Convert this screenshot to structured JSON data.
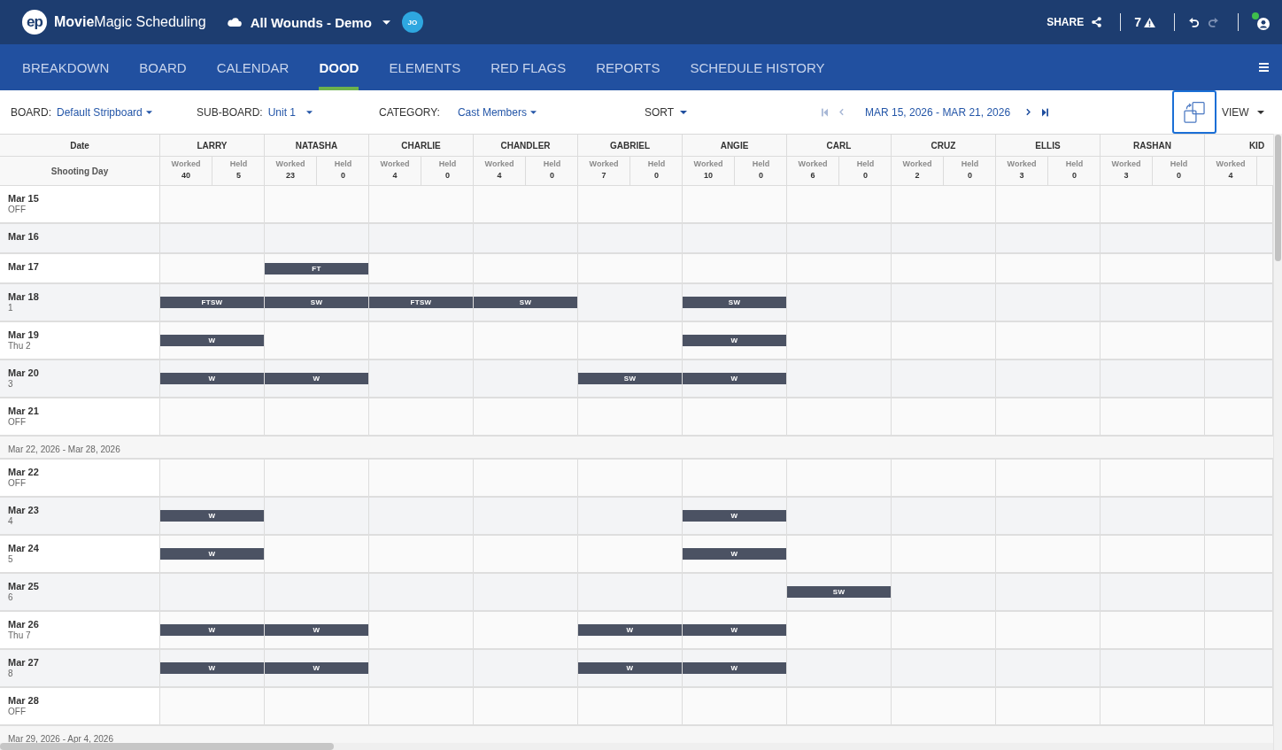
{
  "header": {
    "logo_mark": "ep",
    "app_name": "**Movie**Magic Scheduling",
    "project": "All Wounds - Demo",
    "avatar_initials": "JO",
    "share_label": "SHARE",
    "alert_count": "7",
    "undo": {
      "disabled": false
    },
    "redo": {
      "disabled": true
    },
    "user": {
      "online": true
    }
  },
  "tabs": [
    {
      "label": "BREAKDOWN",
      "selected": false
    },
    {
      "label": "BOARD",
      "selected": false
    },
    {
      "label": "CALENDAR",
      "selected": false
    },
    {
      "label": "DOOD",
      "selected": true
    },
    {
      "label": "ELEMENTS",
      "selected": false
    },
    {
      "label": "RED FLAGS",
      "selected": false
    },
    {
      "label": "REPORTS",
      "selected": false
    },
    {
      "label": "SCHEDULE HISTORY",
      "selected": false
    }
  ],
  "toolbar": {
    "filters": [
      {
        "label": "BOARD:",
        "value": "Default Stripboard"
      },
      {
        "label": "SUB-BOARD:",
        "value": "Unit 1"
      },
      {
        "label": "CATEGORY:",
        "value": "Cast Members"
      }
    ],
    "sort_label": "SORT",
    "date_nav": {
      "first_disabled": true,
      "previous_disabled": true,
      "range": "MAR 15, 2026 - MAR 21, 2026",
      "next_disabled": false,
      "last_disabled": false
    },
    "layout_button": {
      "highlighted": true
    },
    "view_label": "VIEW"
  },
  "table": {
    "date_header": "Date",
    "shooting_day_header": "Shooting Day",
    "cast": [
      {
        "name": "LARRY",
        "worked_label": "Worked",
        "worked": "40",
        "held_label": "Held",
        "held": "5"
      },
      {
        "name": "NATASHA",
        "worked_label": "Worked",
        "worked": "23",
        "held_label": "Held",
        "held": "0"
      },
      {
        "name": "CHARLIE",
        "worked_label": "Worked",
        "worked": "4",
        "held_label": "Held",
        "held": "0"
      },
      {
        "name": "CHANDLER",
        "worked_label": "Worked",
        "worked": "4",
        "held_label": "Held",
        "held": "0"
      },
      {
        "name": "GABRIEL",
        "worked_label": "Worked",
        "worked": "7",
        "held_label": "Held",
        "held": "0"
      },
      {
        "name": "ANGIE",
        "worked_label": "Worked",
        "worked": "10",
        "held_label": "Held",
        "held": "0"
      },
      {
        "name": "CARL",
        "worked_label": "Worked",
        "worked": "6",
        "held_label": "Held",
        "held": "0"
      },
      {
        "name": "CRUZ",
        "worked_label": "Worked",
        "worked": "2",
        "held_label": "Held",
        "held": "0"
      },
      {
        "name": "ELLIS",
        "worked_label": "Worked",
        "worked": "3",
        "held_label": "Held",
        "held": "0"
      },
      {
        "name": "RASHAN",
        "worked_label": "Worked",
        "worked": "3",
        "held_label": "Held",
        "held": "0"
      },
      {
        "name": "KID",
        "worked_label": "Worked",
        "worked": "4"
      }
    ],
    "rows": [
      {
        "kind": "day",
        "date": "Mar 15",
        "note": "OFF",
        "cells": [
          {
            "booked": false
          },
          {
            "booked": false
          },
          {
            "booked": false
          },
          {
            "booked": false
          },
          {
            "booked": false
          },
          {
            "booked": false
          },
          {
            "booked": false
          },
          {
            "booked": false
          },
          {
            "booked": false
          },
          {
            "booked": false
          },
          {
            "booked": false
          }
        ]
      },
      {
        "kind": "day",
        "date": "Mar 16",
        "cells": [
          {
            "booked": false
          },
          {
            "booked": false
          },
          {
            "booked": false
          },
          {
            "booked": false
          },
          {
            "booked": false
          },
          {
            "booked": false
          },
          {
            "booked": false
          },
          {
            "booked": false
          },
          {
            "booked": false
          },
          {
            "booked": false
          },
          {
            "booked": false
          }
        ]
      },
      {
        "kind": "day",
        "date": "Mar 17",
        "cells": [
          {
            "booked": false
          },
          {
            "booked": true,
            "code": "FT"
          },
          {
            "booked": false
          },
          {
            "booked": false
          },
          {
            "booked": false
          },
          {
            "booked": false
          },
          {
            "booked": false
          },
          {
            "booked": false
          },
          {
            "booked": false
          },
          {
            "booked": false
          },
          {
            "booked": false
          }
        ]
      },
      {
        "kind": "day",
        "date": "Mar 18",
        "note": "1",
        "cells": [
          {
            "booked": true,
            "code": "FTSW"
          },
          {
            "booked": true,
            "code": "SW"
          },
          {
            "booked": true,
            "code": "FTSW"
          },
          {
            "booked": true,
            "code": "SW"
          },
          {
            "booked": false
          },
          {
            "booked": true,
            "code": "SW"
          },
          {
            "booked": false
          },
          {
            "booked": false
          },
          {
            "booked": false
          },
          {
            "booked": false
          },
          {
            "booked": false
          }
        ]
      },
      {
        "kind": "day",
        "date": "Mar 19",
        "note": "Thu 2",
        "cells": [
          {
            "booked": true,
            "code": "W"
          },
          {
            "booked": false
          },
          {
            "booked": false
          },
          {
            "booked": false
          },
          {
            "booked": false
          },
          {
            "booked": true,
            "code": "W"
          },
          {
            "booked": false
          },
          {
            "booked": false
          },
          {
            "booked": false
          },
          {
            "booked": false
          },
          {
            "booked": false
          }
        ]
      },
      {
        "kind": "day",
        "date": "Mar 20",
        "note": "3",
        "cells": [
          {
            "booked": true,
            "code": "W"
          },
          {
            "booked": true,
            "code": "W"
          },
          {
            "booked": false
          },
          {
            "booked": false
          },
          {
            "booked": true,
            "code": "SW"
          },
          {
            "booked": true,
            "code": "W"
          },
          {
            "booked": false
          },
          {
            "booked": false
          },
          {
            "booked": false
          },
          {
            "booked": false
          },
          {
            "booked": false
          }
        ]
      },
      {
        "kind": "day",
        "date": "Mar 21",
        "note": "OFF",
        "cells": [
          {
            "booked": false
          },
          {
            "booked": false
          },
          {
            "booked": false
          },
          {
            "booked": false
          },
          {
            "booked": false
          },
          {
            "booked": false
          },
          {
            "booked": false
          },
          {
            "booked": false
          },
          {
            "booked": false
          },
          {
            "booked": false
          },
          {
            "booked": false
          }
        ]
      },
      {
        "kind": "week",
        "label": "Mar 22, 2026 - Mar 28, 2026"
      },
      {
        "kind": "day",
        "date": "Mar 22",
        "note": "OFF",
        "cells": [
          {
            "booked": false
          },
          {
            "booked": false
          },
          {
            "booked": false
          },
          {
            "booked": false
          },
          {
            "booked": false
          },
          {
            "booked": false
          },
          {
            "booked": false
          },
          {
            "booked": false
          },
          {
            "booked": false
          },
          {
            "booked": false
          },
          {
            "booked": false
          }
        ]
      },
      {
        "kind": "day",
        "date": "Mar 23",
        "note": "4",
        "cells": [
          {
            "booked": true,
            "code": "W"
          },
          {
            "booked": false
          },
          {
            "booked": false
          },
          {
            "booked": false
          },
          {
            "booked": false
          },
          {
            "booked": true,
            "code": "W"
          },
          {
            "booked": false
          },
          {
            "booked": false
          },
          {
            "booked": false
          },
          {
            "booked": false
          },
          {
            "booked": false
          }
        ]
      },
      {
        "kind": "day",
        "date": "Mar 24",
        "note": "5",
        "cells": [
          {
            "booked": true,
            "code": "W"
          },
          {
            "booked": false
          },
          {
            "booked": false
          },
          {
            "booked": false
          },
          {
            "booked": false
          },
          {
            "booked": true,
            "code": "W"
          },
          {
            "booked": false
          },
          {
            "booked": false
          },
          {
            "booked": false
          },
          {
            "booked": false
          },
          {
            "booked": false
          }
        ]
      },
      {
        "kind": "day",
        "date": "Mar 25",
        "note": "6",
        "cells": [
          {
            "booked": false
          },
          {
            "booked": false
          },
          {
            "booked": false
          },
          {
            "booked": false
          },
          {
            "booked": false
          },
          {
            "booked": false
          },
          {
            "booked": true,
            "code": "SW"
          },
          {
            "booked": false
          },
          {
            "booked": false
          },
          {
            "booked": false
          },
          {
            "booked": false
          }
        ]
      },
      {
        "kind": "day",
        "date": "Mar 26",
        "note": "Thu 7",
        "cells": [
          {
            "booked": true,
            "code": "W"
          },
          {
            "booked": true,
            "code": "W"
          },
          {
            "booked": false
          },
          {
            "booked": false
          },
          {
            "booked": true,
            "code": "W"
          },
          {
            "booked": true,
            "code": "W"
          },
          {
            "booked": false
          },
          {
            "booked": false
          },
          {
            "booked": false
          },
          {
            "booked": false
          },
          {
            "booked": false
          }
        ]
      },
      {
        "kind": "day",
        "date": "Mar 27",
        "note": "8",
        "cells": [
          {
            "booked": true,
            "code": "W"
          },
          {
            "booked": true,
            "code": "W"
          },
          {
            "booked": false
          },
          {
            "booked": false
          },
          {
            "booked": true,
            "code": "W"
          },
          {
            "booked": true,
            "code": "W"
          },
          {
            "booked": false
          },
          {
            "booked": false
          },
          {
            "booked": false
          },
          {
            "booked": false
          },
          {
            "booked": false
          }
        ]
      },
      {
        "kind": "day",
        "date": "Mar 28",
        "note": "OFF",
        "cells": [
          {
            "booked": false
          },
          {
            "booked": false
          },
          {
            "booked": false
          },
          {
            "booked": false
          },
          {
            "booked": false
          },
          {
            "booked": false
          },
          {
            "booked": false
          },
          {
            "booked": false
          },
          {
            "booked": false
          },
          {
            "booked": false
          },
          {
            "booked": false
          }
        ]
      },
      {
        "kind": "week",
        "label": "Mar 29, 2026 - Apr 4, 2026"
      }
    ]
  }
}
